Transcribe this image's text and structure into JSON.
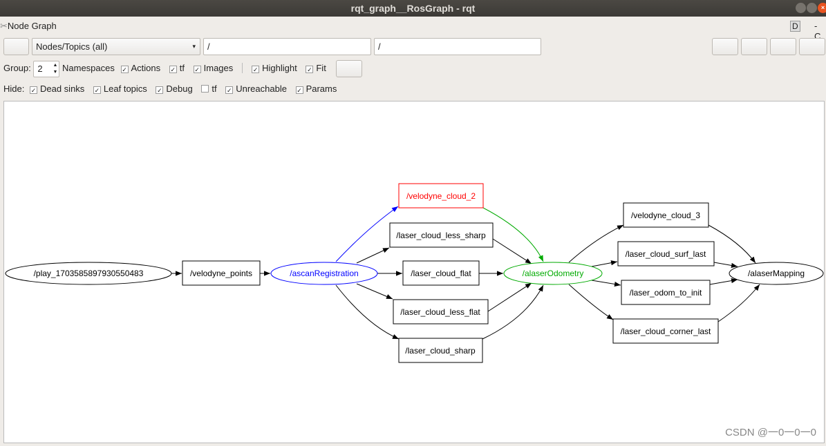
{
  "window": {
    "title": "rqt_graph__RosGraph - rqt",
    "close_glyph": "×"
  },
  "plugin": {
    "title": "Node Graph",
    "d_label": "D",
    "extra": "- C"
  },
  "toolbar": {
    "filter_select": "Nodes/Topics (all)",
    "node_filter": "/",
    "topic_filter": "/"
  },
  "options": {
    "group_label": "Group:",
    "group_value": "2",
    "namespaces": "Namespaces",
    "actions": {
      "label": "Actions",
      "checked": true
    },
    "tf": {
      "label": "tf",
      "checked": true
    },
    "images": {
      "label": "Images",
      "checked": true
    },
    "highlight": {
      "label": "Highlight",
      "checked": true
    },
    "fit": {
      "label": "Fit",
      "checked": true
    }
  },
  "hide": {
    "label": "Hide:",
    "dead_sinks": {
      "label": "Dead sinks",
      "checked": true
    },
    "leaf_topics": {
      "label": "Leaf topics",
      "checked": true
    },
    "debug": {
      "label": "Debug",
      "checked": true
    },
    "tf": {
      "label": "tf",
      "checked": false
    },
    "unreachable": {
      "label": "Unreachable",
      "checked": true
    },
    "params": {
      "label": "Params",
      "checked": true
    }
  },
  "graph": {
    "nodes": {
      "play": "/play_1703585897930550483",
      "velodyne_points": "/velodyne_points",
      "ascan": "/ascanRegistration",
      "vc2": "/velodyne_cloud_2",
      "less_sharp": "/laser_cloud_less_sharp",
      "flat": "/laser_cloud_flat",
      "less_flat": "/laser_cloud_less_flat",
      "sharp": "/laser_cloud_sharp",
      "odom": "/alaserOdometry",
      "vc3": "/velodyne_cloud_3",
      "surf_last": "/laser_cloud_surf_last",
      "odom_to_init": "/laser_odom_to_init",
      "corner_last": "/laser_cloud_corner_last",
      "mapping": "/alaserMapping"
    },
    "colors": {
      "highlight_topic": "#ff0000",
      "registration": "#0000ff",
      "odometry": "#00a000"
    }
  },
  "watermark": "CSDN @一0一0一0"
}
